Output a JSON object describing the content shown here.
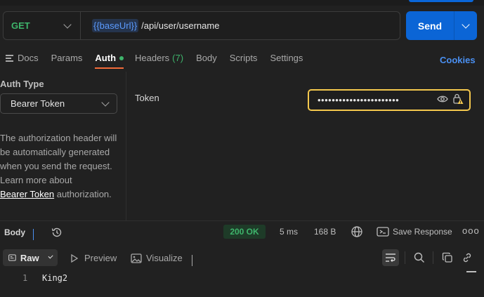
{
  "request": {
    "method": "GET",
    "url_variable": "{{baseUrl}}",
    "url_path": "/api/user/username",
    "send_label": "Send"
  },
  "tabs": [
    {
      "label": "Docs"
    },
    {
      "label": "Params"
    },
    {
      "label": "Auth",
      "active": true,
      "indicator": "green-dot"
    },
    {
      "label": "Headers",
      "count": "(7)"
    },
    {
      "label": "Body"
    },
    {
      "label": "Scripts"
    },
    {
      "label": "Settings"
    }
  ],
  "cookies_label": "Cookies",
  "auth": {
    "type_label": "Auth Type",
    "selected_type": "Bearer Token",
    "description": "The authorization header will be automatically generated when you send the request. Learn more about",
    "link_text": "Bearer Token",
    "description_suffix": "authorization.",
    "token_label": "Token",
    "token_value_masked": "•••••••••••••••••••••••"
  },
  "response": {
    "body_label": "Body",
    "status": "200 OK",
    "time": "5 ms",
    "size": "168 B",
    "save_label": "Save Response",
    "more": "ooo",
    "view_modes": {
      "raw": "Raw",
      "preview": "Preview",
      "visualize": "Visualize"
    },
    "lines": [
      {
        "number": "1",
        "text": "King2"
      }
    ]
  },
  "colors": {
    "accent_orange": "#f26b3a",
    "send_blue": "#0b65d6",
    "method_green": "#3eb46b",
    "token_warning": "#f4c84d",
    "link_blue": "#4a90f2"
  }
}
